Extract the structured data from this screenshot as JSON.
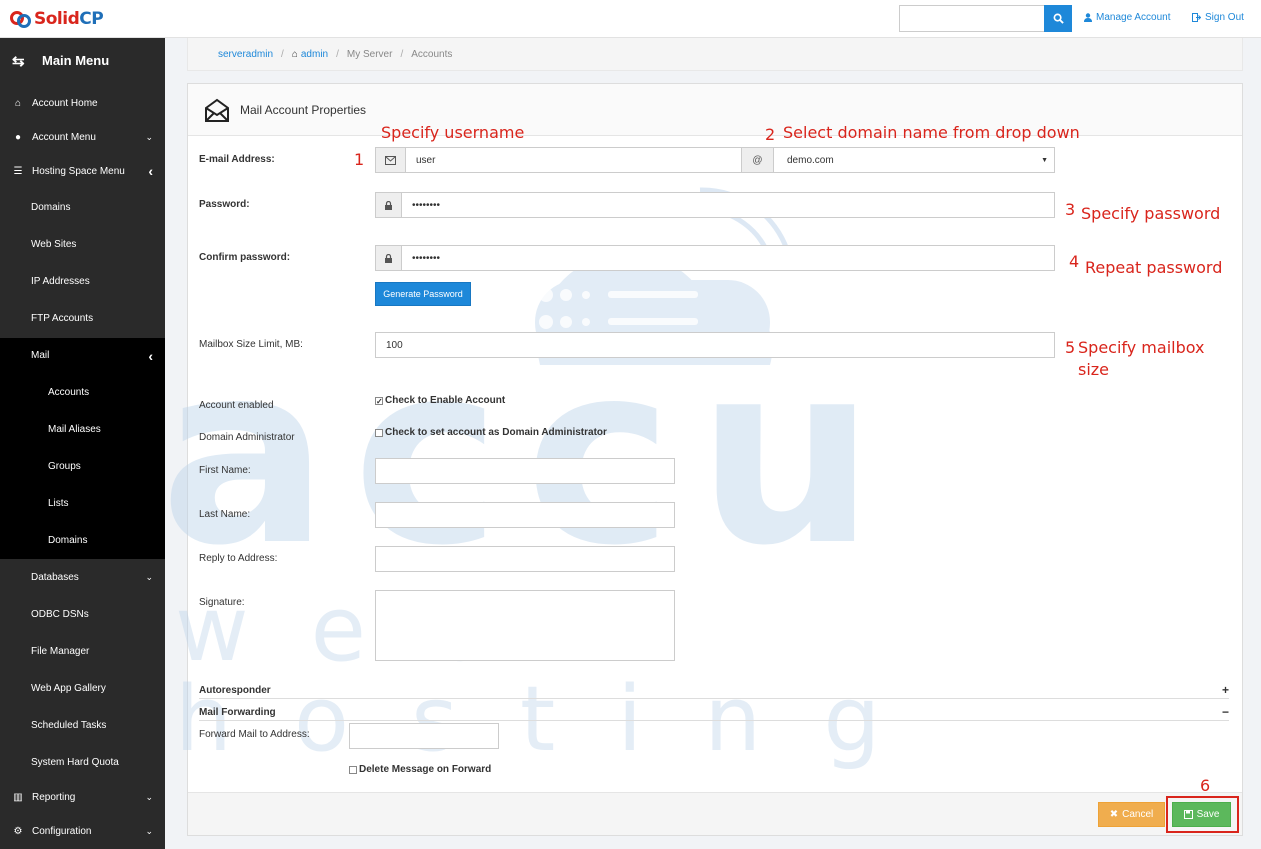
{
  "brand": {
    "part1": "Solid",
    "part2": "CP"
  },
  "topbar": {
    "search_placeholder": "",
    "manage_account": "Manage Account",
    "sign_out": "Sign Out"
  },
  "sidebar": {
    "title": "Main Menu",
    "account_home": "Account Home",
    "account_menu": "Account Menu",
    "hosting_space_menu": "Hosting Space Menu",
    "items": [
      "Domains",
      "Web Sites",
      "IP Addresses",
      "FTP Accounts",
      "Mail"
    ],
    "mail_items": [
      "Accounts",
      "Mail Aliases",
      "Groups",
      "Lists",
      "Domains"
    ],
    "lower_items": [
      "Databases",
      "ODBC DSNs",
      "File Manager",
      "Web App Gallery",
      "Scheduled Tasks",
      "System Hard Quota"
    ],
    "reporting": "Reporting",
    "configuration": "Configuration"
  },
  "breadcrumb": {
    "serveradmin": "serveradmin",
    "admin": "admin",
    "server": "My Server",
    "page": "Accounts"
  },
  "panel": {
    "title": "Mail Account Properties"
  },
  "form": {
    "email_label": "E-mail Address:",
    "username": "user",
    "at": "@",
    "domain": "demo.com",
    "password_label": "Password:",
    "password_value": "••••••••",
    "confirm_label": "Confirm password:",
    "confirm_value": "••••••••",
    "generate": "Generate Password",
    "mailbox_label": "Mailbox Size Limit, MB:",
    "mailbox_value": "100",
    "enabled_label": "Account enabled",
    "enabled_check": "Check to Enable Account",
    "domain_admin_label": "Domain Administrator",
    "domain_admin_check": "Check to set account as Domain Administrator",
    "first_name": "First Name:",
    "last_name": "Last Name:",
    "reply_to": "Reply to Address:",
    "signature": "Signature:",
    "autoresponder": "Autoresponder",
    "autoresponder_toggle": "+",
    "mail_forwarding": "Mail Forwarding",
    "mail_forwarding_toggle": "−",
    "forward_label": "Forward Mail to Address:",
    "delete_on_forward": "Delete Message on Forward"
  },
  "footer": {
    "cancel": "Cancel",
    "save": "Save"
  },
  "annotations": {
    "n1": "1",
    "t1": "Specify username",
    "n2": "2",
    "t2": "Select domain name from drop down",
    "n3": "3",
    "t3": "Specify password",
    "n4": "4",
    "t4": "Repeat password",
    "n5": "5",
    "t5a": "Specify mailbox",
    "t5b": "size",
    "n6": "6"
  },
  "watermark": {
    "big": "accu",
    "small": "web hosting"
  },
  "colors": {
    "accent": "#1e88d9",
    "sidebar": "#2a2a2a",
    "annotation": "#d9251c",
    "save": "#5cb85c",
    "cancel": "#f0ad4e"
  }
}
